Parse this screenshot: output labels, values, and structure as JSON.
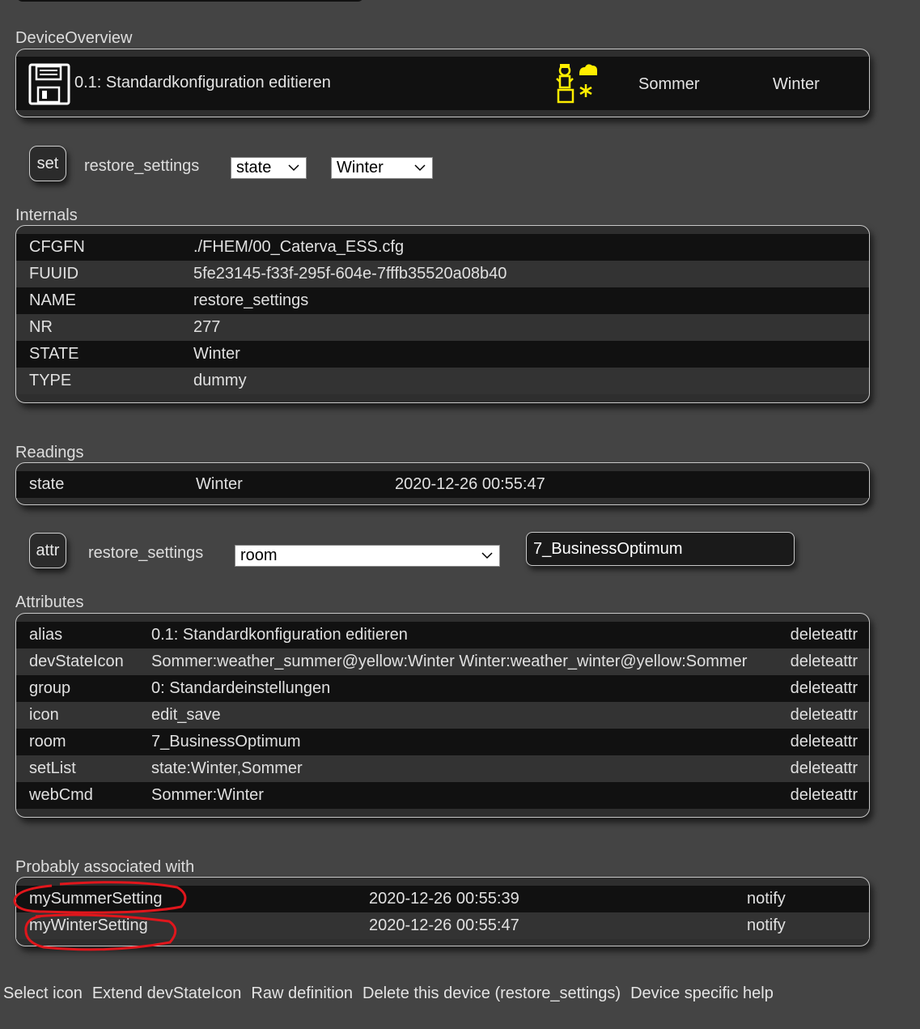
{
  "sections": {
    "overview": "DeviceOverview",
    "internals": "Internals",
    "readings": "Readings",
    "attributes": "Attributes",
    "associated": "Probably associated with"
  },
  "overview": {
    "title": "0.1: Standardkonfiguration editieren",
    "cmd_sommer": "Sommer",
    "cmd_winter": "Winter",
    "icon_color": "#ffee00"
  },
  "set_row": {
    "button": "set",
    "device": "restore_settings",
    "select1": "state",
    "select2": "Winter"
  },
  "internals": [
    {
      "key": "CFGFN",
      "value": "./FHEM/00_Caterva_ESS.cfg"
    },
    {
      "key": "FUUID",
      "value": "5fe23145-f33f-295f-604e-7fffb35520a08b40"
    },
    {
      "key": "NAME",
      "value": "restore_settings"
    },
    {
      "key": "NR",
      "value": "277"
    },
    {
      "key": "STATE",
      "value": "Winter"
    },
    {
      "key": "TYPE",
      "value": "dummy"
    }
  ],
  "readings": [
    {
      "key": "state",
      "value": "Winter",
      "time": "2020-12-26 00:55:47"
    }
  ],
  "attr_row": {
    "button": "attr",
    "device": "restore_settings",
    "select": "room",
    "value": "7_BusinessOptimum"
  },
  "attributes": [
    {
      "key": "alias",
      "value": "0.1: Standardkonfiguration editieren",
      "action": "deleteattr"
    },
    {
      "key": "devStateIcon",
      "value": "Sommer:weather_summer@yellow:Winter Winter:weather_winter@yellow:Sommer",
      "action": "deleteattr"
    },
    {
      "key": "group",
      "value": "0: Standardeinstellungen",
      "action": "deleteattr"
    },
    {
      "key": "icon",
      "value": "edit_save",
      "action": "deleteattr"
    },
    {
      "key": "room",
      "value": "7_BusinessOptimum",
      "action": "deleteattr"
    },
    {
      "key": "setList",
      "value": "state:Winter,Sommer",
      "action": "deleteattr"
    },
    {
      "key": "webCmd",
      "value": "Sommer:Winter",
      "action": "deleteattr"
    }
  ],
  "associated": [
    {
      "name": "mySummerSetting",
      "time": "2020-12-26 00:55:39",
      "type": "notify"
    },
    {
      "name": "myWinterSetting",
      "time": "2020-12-26 00:55:47",
      "type": "notify"
    }
  ],
  "annotation_color": "#e0161c",
  "footer": [
    "Select icon",
    "Extend devStateIcon",
    "Raw definition",
    "Delete this device (restore_settings)",
    "Device specific help"
  ]
}
